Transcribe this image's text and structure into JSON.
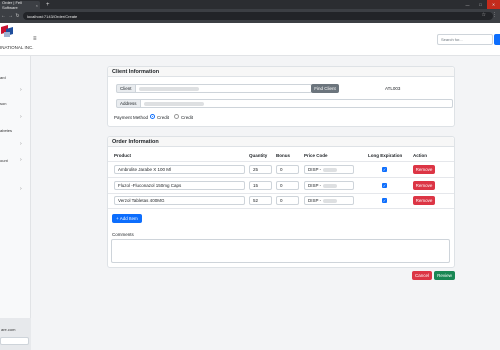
{
  "browser": {
    "tab_title": "Order | Fell Software",
    "tab_close": "×",
    "new_tab": "+",
    "url": "localhost:7143/Order/Create",
    "win_min": "—",
    "win_max": "□",
    "win_close": "✕",
    "back": "←",
    "forward": "→",
    "reload": "↻",
    "star": "☆",
    "menu": "⋮"
  },
  "header": {
    "brand": "INATIONAL INC.",
    "menu_icon": "≡",
    "search_placeholder": "Search for..."
  },
  "sidebar": {
    "items": [
      {
        "label": "ard",
        "chevron": ""
      },
      {
        "label": "",
        "chevron": "›"
      },
      {
        "label": "son",
        "chevron": ""
      },
      {
        "label": "",
        "chevron": "›"
      },
      {
        "label": "abetes",
        "chevron": ""
      },
      {
        "label": "",
        "chevron": "›"
      },
      {
        "label": "ount",
        "chevron": "›"
      },
      {
        "label": "",
        "chevron": "›"
      }
    ],
    "footer_text": "are.com"
  },
  "client_section": {
    "title": "Client Information",
    "client_label": "Client",
    "find_button": "Find Client",
    "client_code": "ATL003",
    "address_label": "Address",
    "payment_label": "Payment Method",
    "payment_options": [
      "Credit",
      "Credit"
    ],
    "payment_selected": 0
  },
  "order_section": {
    "title": "Order Information",
    "columns": [
      "Product",
      "Quantity",
      "Bonus",
      "Price Code",
      "Long Expiration",
      "Action"
    ],
    "rows": [
      {
        "product": "Ambrolite Jarabe X 100 Ml",
        "quantity": "25",
        "bonus": "0",
        "price_code": "DISP -",
        "long_expiration": true,
        "action": "Remove"
      },
      {
        "product": "Fluzol -Fluconazol 150mg Caps",
        "quantity": "15",
        "bonus": "0",
        "price_code": "DISP -",
        "long_expiration": true,
        "action": "Remove"
      },
      {
        "product": "Verzol Tabletas 400MG",
        "quantity": "52",
        "bonus": "0",
        "price_code": "DISP -",
        "long_expiration": true,
        "action": "Remove"
      }
    ],
    "add_item": "+ Add Item",
    "comments_label": "Comments"
  },
  "actions": {
    "cancel": "Cancel",
    "review": "Review"
  },
  "icons": {
    "check": "✓"
  },
  "colors": {
    "primary": "#0d6efd",
    "danger": "#dc3545",
    "success": "#198754",
    "secondary": "#6c757d"
  }
}
